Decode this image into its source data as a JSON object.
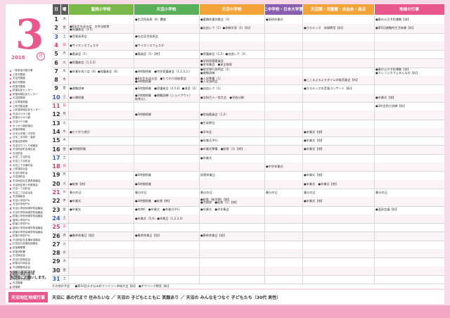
{
  "month": "3",
  "year": "2018",
  "circle_char": "月",
  "headers": [
    {
      "label": "日",
      "color": "#5a5a5a"
    },
    {
      "label": "曜",
      "color": "#5a5a5a"
    },
    {
      "label": "富岡小学校",
      "color": "#7ab84a"
    },
    {
      "label": "天沼小学校",
      "color": "#5ab05a"
    },
    {
      "label": "天沼中学校",
      "color": "#f2a33a"
    },
    {
      "label": "日本大学第二中学校・日本大学第二高等学校",
      "color": "#8a5fb0"
    },
    {
      "label": "天沼図・児童館・自治会・商店",
      "color": "#f2a33a"
    },
    {
      "label": "地域の行事",
      "color": "#e8588a"
    }
  ],
  "legend": [
    "一般参加可能行事",
    "上荻児童館",
    "天沼児童館",
    "桃井児童館",
    "荻窪児童館",
    "荻窪区民センター",
    "荻窪地域区民センター",
    "天沼図書館",
    "上井草図書館",
    "上荻児童会館",
    "上荻窪地域区民センター",
    "天沼ゆうゆう館",
    "荻窪ゆうゆう館",
    "天沼けやき館",
    "ゆうゆう館荻窪北",
    "荻窪体育館",
    "日本大学第二中学校",
    "日本二中学校・高校",
    "荻窪北診療所",
    "天沼まちづくり協議会",
    "天沼地区町会連合会",
    "天沼町会",
    "天沼二丁目町会",
    "天沼三丁目町会",
    "天沼三丁目東町会",
    "上荻窪自治会",
    "天沼中央町会",
    "天沼西町会",
    "天沼地区民生委員協議会",
    "天沼地区青少年委員会",
    "天沼一丁目町会",
    "天沼二丁目自治会",
    "天沼高齢会",
    "天沼小学校PTA",
    "天沼中学校PTA",
    "天沼小学校地域学校協議会",
    "天沼中学校地域学校協議会",
    "荻窪小学校地域学校協議会",
    "富岡小学校PTA",
    "荻窪小学校PTA",
    "富岡小学校地域学校協議会",
    "荻窪中学校地域学校協議会",
    "荻窪中学校PTA",
    "天沼地区社会福祉協議会",
    "杉並区社会福祉協議会",
    "荻窪警察署",
    "荻窪消防署",
    "天沼商店会",
    "天沼中央商店会",
    "荻窪北口商店会",
    "天沼銀座商店会",
    "杉並区役所荻窪分室",
    "天沼けやき公園",
    "天沼弁天池公園",
    "天沼陸橋",
    "荻窪駅",
    "阿佐ヶ谷駅",
    "天沼児童遊園"
  ],
  "notice": "お問い合わせは\n各団体にお願いします。",
  "rows": [
    {
      "d": "1",
      "w": "木",
      "t": "",
      "c": [
        "",
        "●生活科発表（6）體會",
        "●量積体重測量会（3）",
        "●高校卒業式",
        "",
        "●春の火災予防運動【本】"
      ]
    },
    {
      "d": "2",
      "w": "金",
      "t": "",
      "c": [
        "●6年生を送る会　お弁当給食\n●保護者会（4,5）",
        "",
        "●自由レク（1）●体験学習（2）【料】",
        "",
        "●ひろキッズ　体操教室【料】",
        "●第5回避難所生活体験【料】"
      ]
    },
    {
      "d": "3",
      "w": "土",
      "t": "sat",
      "c": [
        "●音楽発表会",
        "●社会見学発表会",
        "",
        "",
        "",
        ""
      ]
    },
    {
      "d": "4",
      "w": "日",
      "t": "sun",
      "c": [
        "●サイエンスフェスタ",
        "●サイエンスフェスタ",
        "",
        "",
        "",
        ""
      ]
    },
    {
      "d": "5",
      "w": "月",
      "t": "",
      "c": [
        "●委員会（1）",
        "●委員会（1）【終】",
        "●保護者会（1,2）●自由レク（3）",
        "",
        "",
        ""
      ]
    },
    {
      "d": "6",
      "w": "火",
      "t": "",
      "c": [
        "●保護者会（1,2,3）",
        "",
        "●学校保健委員会\n●学年集会　●安全指導",
        "",
        "",
        ""
      ]
    },
    {
      "d": "7",
      "w": "水",
      "t": "",
      "c": [
        "●卒業を祝う会（6）●保護者会（6）",
        "●4時間授業　●特別保護者会（1,2,3,二）",
        "●修学旅行説明会（1）\n●避難訓練",
        "",
        "",
        "●春の火災予防運動【本】\n●オレンジカフェみんなの【料】"
      ]
    },
    {
      "d": "8",
      "w": "木",
      "t": "",
      "c": [
        "",
        "●6年生を送る会　●たてわり班給食会\n●3時間授業",
        "●入学準備（1）\n●入学説明会",
        "",
        "●ここるよろよろダイム学級音楽会【料】",
        ""
      ]
    },
    {
      "d": "9",
      "w": "金",
      "t": "",
      "c": [
        "●避難訓練",
        "●5時間授業　●保護者会（4,5,6）●退室（2）",
        "●自由レク（1）",
        "",
        "●ひろキッズの音楽コンサート【料】",
        ""
      ]
    },
    {
      "d": "10",
      "w": "土",
      "t": "sat",
      "c": [
        "●公開授業",
        "●1時間授業　●避難訓練（ショイアウト）\n給食なし",
        "●全校百人一首大会　●学校公開",
        "",
        "",
        "●卒業式【他】"
      ]
    },
    {
      "d": "11",
      "w": "日",
      "t": "sun",
      "c": [
        "",
        "",
        "",
        "",
        "",
        "●3町会防災訓練【料】"
      ]
    },
    {
      "d": "12",
      "w": "月",
      "t": "",
      "c": [
        "",
        "●5時間授業",
        "●陸協委員会（1,2）",
        "",
        "",
        ""
      ]
    },
    {
      "d": "13",
      "w": "火",
      "t": "",
      "c": [
        "",
        "",
        "●生徒朝会",
        "",
        "",
        ""
      ]
    },
    {
      "d": "14",
      "w": "水",
      "t": "",
      "c": [
        "●たてわり遊び",
        "",
        "●学年会",
        "",
        "●卒業式【他】",
        ""
      ]
    },
    {
      "d": "15",
      "w": "木",
      "t": "",
      "c": [
        "",
        "",
        "●卒業式予行",
        "",
        "●卒業式【他】",
        ""
      ]
    },
    {
      "d": "16",
      "w": "金",
      "t": "",
      "c": [
        "●5時間授業",
        "",
        "●卒業式準備　●給食（3）【終】",
        "",
        "●卒業式【他】",
        ""
      ]
    },
    {
      "d": "17",
      "w": "土",
      "t": "sat",
      "c": [
        "",
        "",
        "●卒業式",
        "",
        "",
        ""
      ]
    },
    {
      "d": "18",
      "w": "日",
      "t": "sun",
      "c": [
        "",
        "",
        "",
        "●中学卒業式",
        "",
        ""
      ]
    },
    {
      "d": "19",
      "w": "月",
      "t": "",
      "c": [
        "",
        "●5時間授業",
        "振替休業日",
        "",
        "●卒業式【他】",
        ""
      ]
    },
    {
      "d": "20",
      "w": "火",
      "t": "",
      "c": [
        "●給食【終】",
        "●5時間授業",
        "",
        "",
        "●卒業式　●卒業式【他】",
        ""
      ]
    },
    {
      "d": "21",
      "w": "水",
      "t": "sun",
      "c": [
        "春分の日",
        "春分の日",
        "春分の日",
        "春分の日",
        "春分の日",
        "春分の日"
      ]
    },
    {
      "d": "22",
      "w": "木",
      "t": "",
      "c": [
        "●卒業式",
        "●3時間授業　●給食【終】",
        "●給食（新学期）【終】\n●大掃除　●給食（1）【終】",
        "",
        "●卒業式【他】",
        ""
      ]
    },
    {
      "d": "23",
      "w": "金",
      "t": "",
      "c": [
        "●卒業式",
        "●特時6　●卒業式　●卒業式予行",
        "●卒業式　●学年集会",
        "",
        "",
        "●温泉会議【料】"
      ]
    },
    {
      "d": "24",
      "w": "土",
      "t": "sat",
      "c": [
        "",
        "●卒業式（5,6）●休業日（1,2,3,4）",
        "",
        "",
        "",
        ""
      ]
    },
    {
      "d": "25",
      "w": "日",
      "t": "sun",
      "c": [
        "",
        "",
        "",
        "",
        "",
        ""
      ]
    },
    {
      "d": "26",
      "w": "月",
      "t": "",
      "c": [
        "●春季休業日【他】",
        "●春季休業日【他】",
        "●春季休業日【他】",
        "",
        "",
        ""
      ]
    },
    {
      "d": "27",
      "w": "火",
      "t": "",
      "c": [
        "",
        "",
        "",
        "",
        "",
        ""
      ]
    },
    {
      "d": "28",
      "w": "水",
      "t": "",
      "c": [
        "",
        "",
        "",
        "",
        "",
        ""
      ]
    },
    {
      "d": "29",
      "w": "木",
      "t": "",
      "c": [
        "",
        "",
        "",
        "",
        "",
        ""
      ]
    },
    {
      "d": "30",
      "w": "金",
      "t": "",
      "c": [
        "",
        "",
        "",
        "",
        "",
        ""
      ]
    },
    {
      "d": "31",
      "w": "土",
      "t": "sat",
      "c": [
        "",
        "",
        "",
        "",
        "",
        ""
      ]
    }
  ],
  "other_label": "その他の予定",
  "other_text": "●第16回すぎなみ杯ファミリー卓球大会【料】　●ボウリング教室【料】",
  "footer_badge": "天沼地区地域行事",
  "footer_slogan": "天沼に 孫の代まで 住みたいな ／ 天沼の 子どもとともに 笑顔あり ／ 天沼の みんなをつなぐ 子どもたち（30代 男性）"
}
